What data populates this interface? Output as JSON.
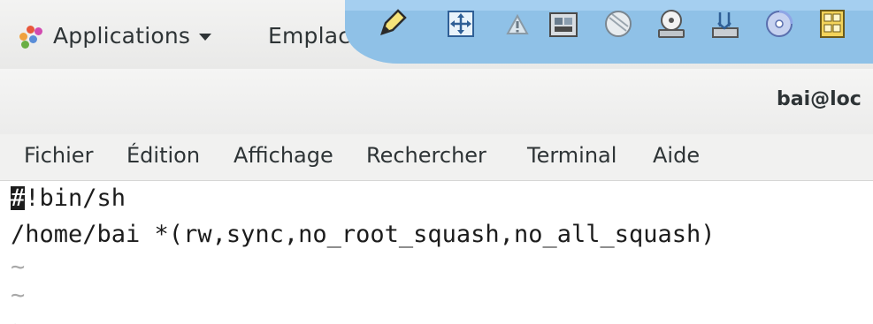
{
  "top_panel": {
    "applications_label": "Applications",
    "places_label": "Emplace.",
    "launchers": [
      {
        "icon": "pen-icon"
      },
      {
        "icon": "move-icon"
      },
      {
        "icon": "warning-triangle-icon"
      },
      {
        "icon": "film-icon"
      },
      {
        "icon": "sphere-icon"
      },
      {
        "icon": "disc-drive-icon"
      },
      {
        "icon": "disk-install-icon"
      },
      {
        "icon": "dvd-icon"
      },
      {
        "icon": "cda-icon"
      }
    ],
    "colors": {
      "panel_bg": "#eeeeee",
      "launcher_bg": "#8fc1e7"
    }
  },
  "window": {
    "title": "bai@loc"
  },
  "menubar": {
    "items": [
      "Fichier",
      "Édition",
      "Affichage",
      "Rechercher",
      "Terminal",
      "Aide"
    ]
  },
  "terminal": {
    "cursor_char": "#",
    "lines": [
      "!bin/sh",
      "/home/bai *(rw,sync,no_root_squash,no_all_squash)",
      "~",
      "~",
      "~"
    ]
  }
}
